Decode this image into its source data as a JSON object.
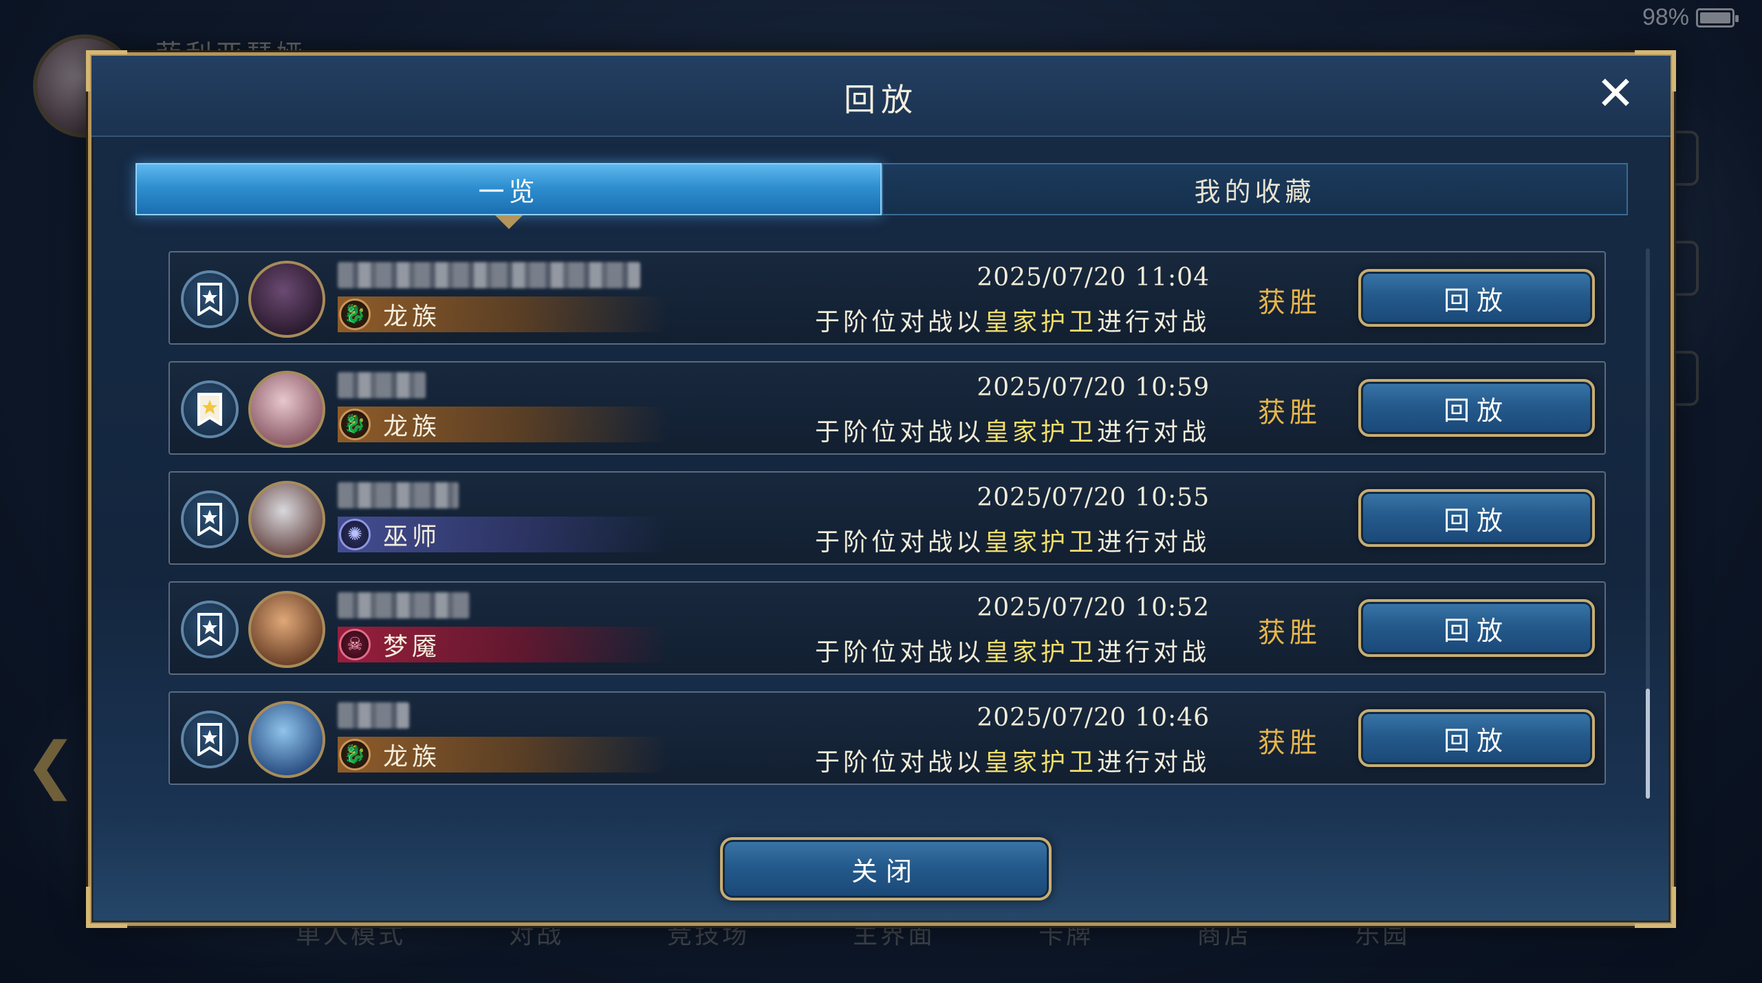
{
  "status": {
    "battery": "98%"
  },
  "background": {
    "player_name": "菲利亚瑟娅",
    "nav": [
      "单人模式",
      "对战",
      "竞技场",
      "主界面",
      "卡牌",
      "商店",
      "乐园"
    ]
  },
  "modal": {
    "title": "回放",
    "tabs": [
      {
        "label": "一览",
        "active": true
      },
      {
        "label": "我的收藏",
        "active": false
      }
    ],
    "close_label": "关闭"
  },
  "colors": {
    "accent_gold": "#c8ad72",
    "win_gold": "#e6b54a",
    "highlight_yellow": "#f2dd6a"
  },
  "replays": [
    {
      "favorited": false,
      "class": "龙族",
      "class_key": "dragon",
      "class_icon": "dragon-icon",
      "datetime": "2025/07/20  11:04",
      "desc_pre": "于阶位对战以",
      "deck": "皇家护卫",
      "desc_post": "进行对战",
      "result": "获胜",
      "button": "回放"
    },
    {
      "favorited": true,
      "class": "龙族",
      "class_key": "dragon",
      "class_icon": "dragon-icon",
      "datetime": "2025/07/20  10:59",
      "desc_pre": "于阶位对战以",
      "deck": "皇家护卫",
      "desc_post": "进行对战",
      "result": "获胜",
      "button": "回放"
    },
    {
      "favorited": false,
      "class": "巫师",
      "class_key": "mage",
      "class_icon": "rune-icon",
      "datetime": "2025/07/20  10:55",
      "desc_pre": "于阶位对战以",
      "deck": "皇家护卫",
      "desc_post": "进行对战",
      "result": "",
      "button": "回放"
    },
    {
      "favorited": false,
      "class": "梦魇",
      "class_key": "nightmare",
      "class_icon": "skull-icon",
      "datetime": "2025/07/20  10:52",
      "desc_pre": "于阶位对战以",
      "deck": "皇家护卫",
      "desc_post": "进行对战",
      "result": "获胜",
      "button": "回放"
    },
    {
      "favorited": false,
      "class": "龙族",
      "class_key": "dragon",
      "class_icon": "dragon-icon",
      "datetime": "2025/07/20  10:46",
      "desc_pre": "于阶位对战以",
      "deck": "皇家护卫",
      "desc_post": "进行对战",
      "result": "获胜",
      "button": "回放"
    }
  ]
}
